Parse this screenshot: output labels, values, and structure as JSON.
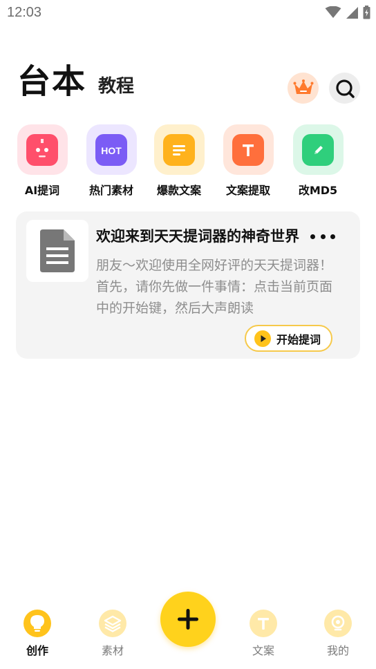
{
  "status_bar": {
    "time": "12:03",
    "icons": [
      "wifi-icon",
      "signal-icon",
      "battery-icon"
    ]
  },
  "header": {
    "title": "台本",
    "subtitle": "教程",
    "actions": [
      "crown-icon",
      "search-icon"
    ]
  },
  "tools": [
    {
      "label": "AI提词",
      "icon": "robot-icon",
      "color": "#ff4f6b"
    },
    {
      "label": "热门素材",
      "icon": "hot-folder-icon",
      "color": "#7b5cf5"
    },
    {
      "label": "爆款文案",
      "icon": "document-icon",
      "color": "#ffb21c"
    },
    {
      "label": "文案提取",
      "icon": "text-extract-icon",
      "color": "#ff6f3c"
    },
    {
      "label": "改MD5",
      "icon": "edit-folder-icon",
      "color": "#2fcf7c"
    }
  ],
  "script_card": {
    "title": "欢迎来到天天提词器的神奇世界",
    "body": "朋友～欢迎使用全网好评的天天提词器！ 首先，请你先做一件事情：点击当前页面中的开始键，然后大声朗读",
    "start_label": "开始提词",
    "more_icon": "more-icon"
  },
  "bottom_nav": {
    "items": [
      {
        "label": "创作",
        "icon": "bulb-icon",
        "active": true
      },
      {
        "label": "素材",
        "icon": "layers-icon",
        "active": false
      },
      {
        "label": "文案",
        "icon": "text-icon",
        "active": false
      },
      {
        "label": "我的",
        "icon": "profile-icon",
        "active": false
      }
    ],
    "fab_icon": "plus-icon"
  },
  "colors": {
    "accent": "#ffd21c",
    "card_bg": "#f4f4f4",
    "start_border": "#f6c94a"
  }
}
